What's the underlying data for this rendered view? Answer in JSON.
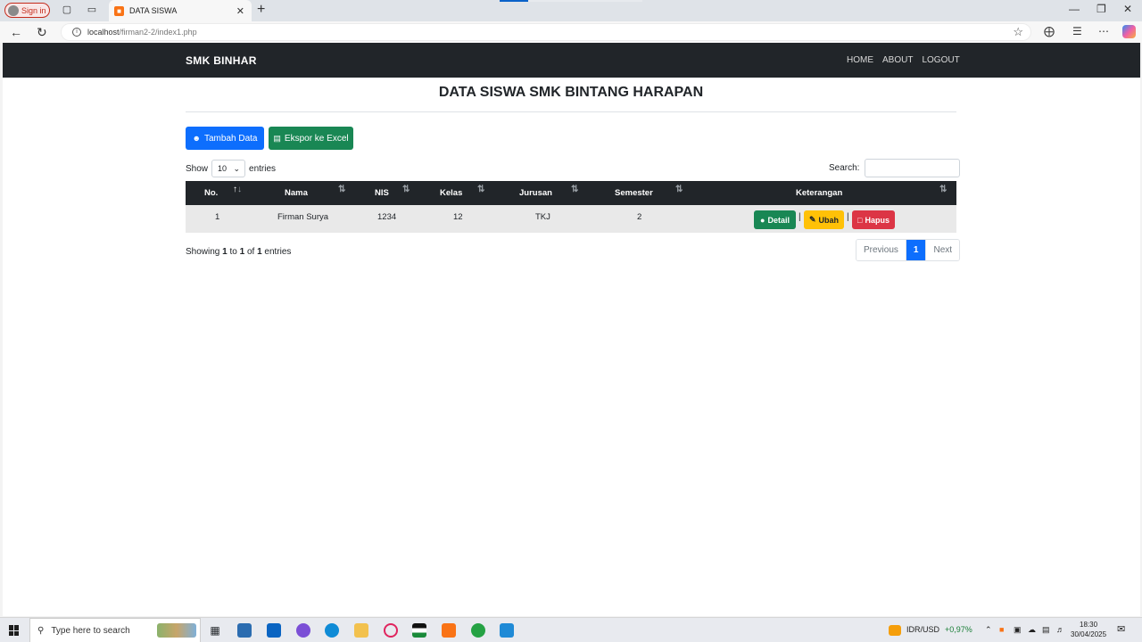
{
  "browser": {
    "signin_label": "Sign in",
    "tab_title": "DATA SISWA",
    "url_host": "localhost",
    "url_path": "/firman2-2/index1.php"
  },
  "navbar": {
    "brand": "SMK BINHAR",
    "links": [
      "HOME",
      "ABOUT",
      "LOGOUT"
    ]
  },
  "page": {
    "title": "DATA SISWA SMK BINTANG HARAPAN",
    "add_button": "Tambah Data",
    "export_button": "Ekspor ke Excel",
    "show_label": "Show",
    "entries_label": "entries",
    "page_length": "10",
    "search_label": "Search:",
    "search_value": "",
    "info_prefix": "Showing ",
    "info_from": "1",
    "info_to_word": " to ",
    "info_to": "1",
    "info_of_word": " of ",
    "info_total": "1",
    "info_suffix": " entries"
  },
  "table": {
    "headers": [
      "No.",
      "Nama",
      "NIS",
      "Kelas",
      "Jurusan",
      "Semester",
      "Keterangan"
    ],
    "rows": [
      {
        "no": "1",
        "nama": "Firman Surya",
        "nis": "1234",
        "kelas": "12",
        "jurusan": "TKJ",
        "semester": "2",
        "actions": [
          "Detail",
          "Ubah",
          "Hapus"
        ],
        "separator": "|"
      }
    ]
  },
  "pagination": {
    "previous": "Previous",
    "current": "1",
    "next": "Next"
  },
  "taskbar": {
    "search_placeholder": "Type here to search",
    "ticker_label": "IDR/USD",
    "ticker_change": "+0,97%",
    "time": "18:30",
    "date": "30/04/2025"
  },
  "colors": {
    "navbar": "#212529",
    "primary": "#0d6efd",
    "success": "#198754",
    "warning": "#ffc107",
    "danger": "#dc3545"
  }
}
